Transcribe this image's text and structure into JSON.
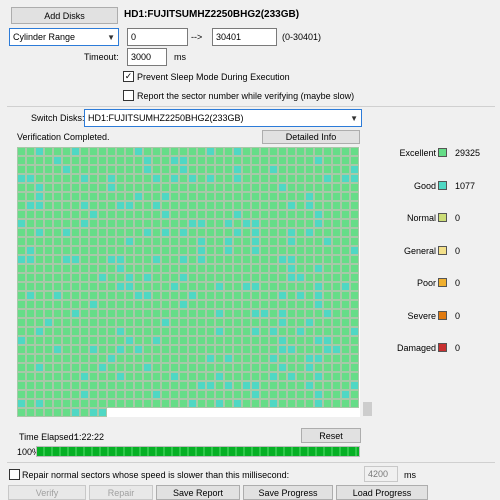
{
  "top": {
    "add_disks": "Add Disks",
    "disk_title": "HD1:FUJITSUMHZ2250BHG2(233GB)",
    "range_mode": "Cylinder Range",
    "range_start": "0",
    "arrow": "-->",
    "range_end": "30401",
    "range_hint": "(0-30401)",
    "timeout_label": "Timeout:",
    "timeout_value": "3000",
    "timeout_unit": "ms",
    "prevent_sleep": "Prevent Sleep Mode During Execution",
    "prevent_sleep_checked": true,
    "report_sector": "Report the sector number while verifying (maybe slow)",
    "report_sector_checked": false
  },
  "switch": {
    "label": "Switch Disks:",
    "value": "HD1:FUJITSUMHZ2250BHG2(233GB)"
  },
  "status": {
    "text": "Verification Completed.",
    "detail_button": "Detailed Info"
  },
  "grid": {
    "colors": {
      "excellent": "#66dd88",
      "good": "#4fd8c4",
      "border": "#a8c8a8"
    },
    "rows": 30,
    "cols": 38,
    "last_row_cells": 10,
    "good_ratio": 0.14
  },
  "legend": [
    {
      "name": "Excellent",
      "count": "29325",
      "color": "#66dd88"
    },
    {
      "name": "Good",
      "count": "1077",
      "color": "#4fd8c4"
    },
    {
      "name": "Normal",
      "count": "0",
      "color": "#ccdd77"
    },
    {
      "name": "General",
      "count": "0",
      "color": "#f3e08a"
    },
    {
      "name": "Poor",
      "count": "0",
      "color": "#f0b030"
    },
    {
      "name": "Severe",
      "count": "0",
      "color": "#e07a10"
    },
    {
      "name": "Damaged",
      "count": "0",
      "color": "#c83030"
    }
  ],
  "time": {
    "label": "Time Elapsed:",
    "value": "1:22:22",
    "reset": "Reset"
  },
  "progress": {
    "label": "100%",
    "fraction": 1.0
  },
  "repair": {
    "text": "Repair normal sectors whose speed is slower than this millisecond:",
    "checked": false,
    "value": "4200",
    "unit": "ms"
  },
  "buttons": {
    "verify": "Verify",
    "repair": "Repair",
    "save_report": "Save Report",
    "save_progress": "Save Progress",
    "load_progress": "Load Progress"
  }
}
